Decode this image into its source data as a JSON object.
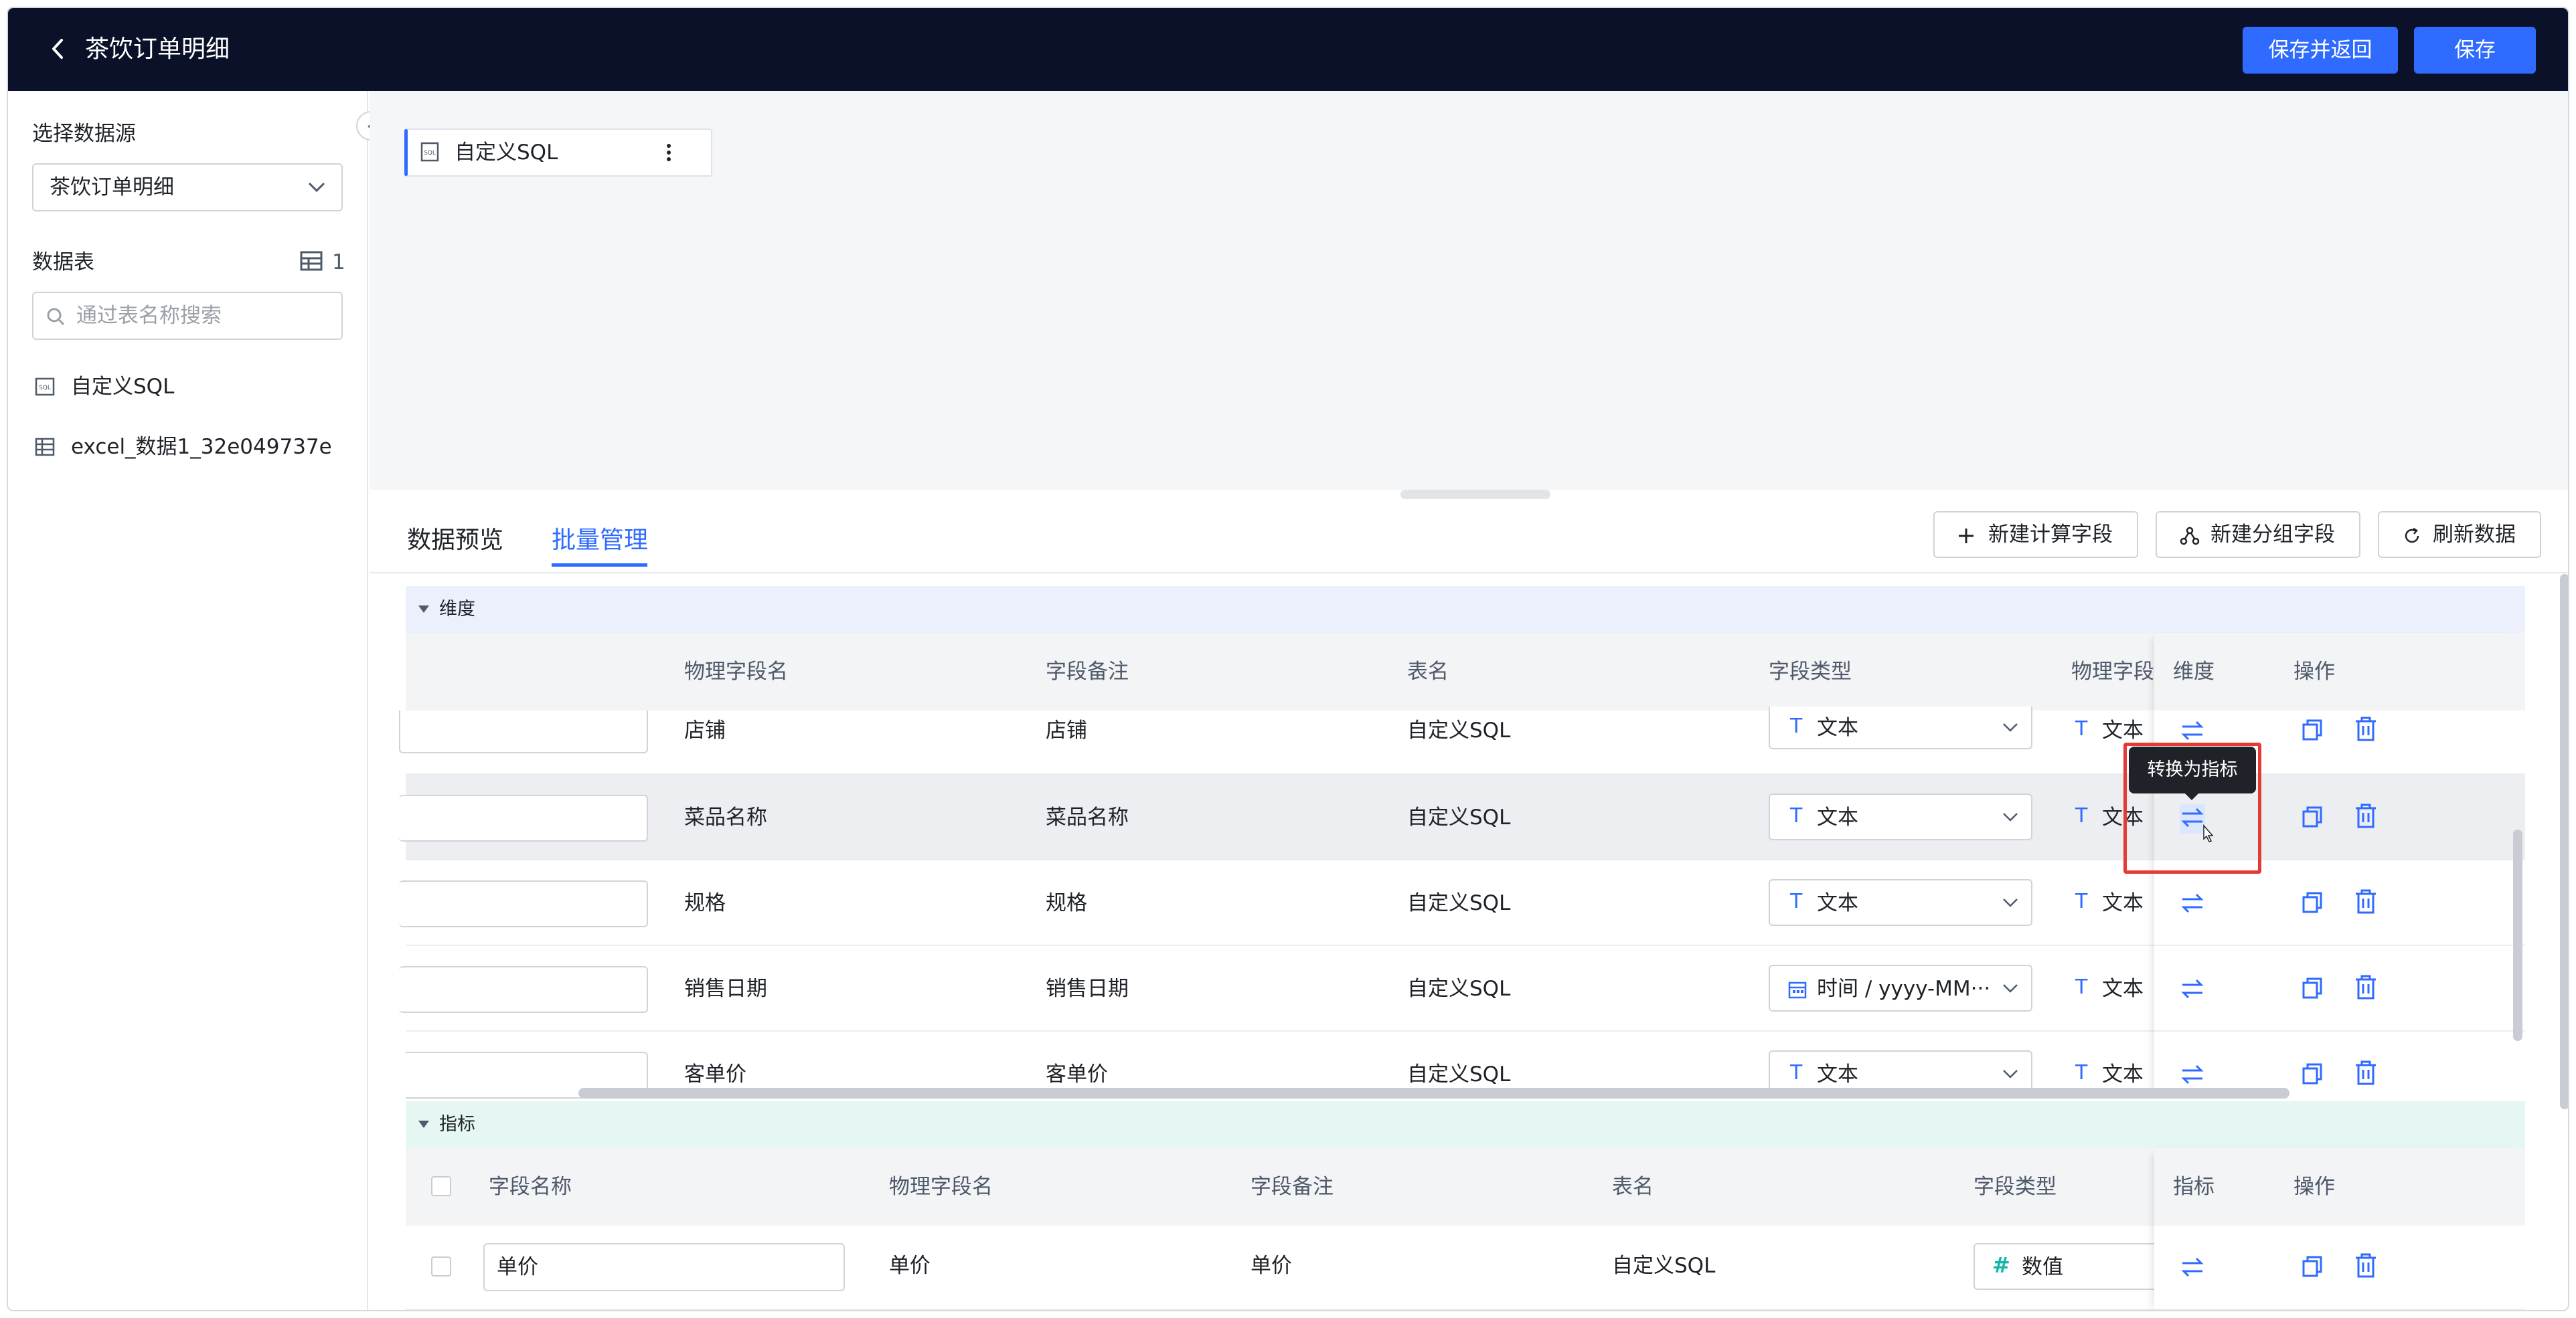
{
  "header": {
    "title": "茶饮订单明细",
    "save_return_label": "保存并返回",
    "save_label": "保存"
  },
  "sidebar": {
    "datasource_label": "选择数据源",
    "datasource_value": "茶饮订单明细",
    "tables_label": "数据表",
    "tables_count": "1",
    "search_placeholder": "通过表名称搜索",
    "tables": [
      {
        "name": "自定义SQL",
        "icon": "sql-file-icon"
      },
      {
        "name": "excel_数据1_32e049737e",
        "icon": "table-icon"
      }
    ]
  },
  "canvas": {
    "node_label": "自定义SQL"
  },
  "tabs": [
    {
      "label": "数据预览",
      "active": false
    },
    {
      "label": "批量管理",
      "active": true
    }
  ],
  "actions": {
    "new_calc_field": "新建计算字段",
    "new_group_field": "新建分组字段",
    "refresh_data": "刷新数据"
  },
  "dimension_group": {
    "title": "维度",
    "columns": [
      "物理字段名",
      "字段备注",
      "表名",
      "字段类型",
      "物理字段",
      "维度",
      "操作"
    ],
    "rows": [
      {
        "physical": "店铺",
        "remark": "店铺",
        "table": "自定义SQL",
        "type": "文本",
        "ptype": "文本"
      },
      {
        "physical": "菜品名称",
        "remark": "菜品名称",
        "table": "自定义SQL",
        "type": "文本",
        "ptype": "文本"
      },
      {
        "physical": "规格",
        "remark": "规格",
        "table": "自定义SQL",
        "type": "文本",
        "ptype": "文本"
      },
      {
        "physical": "销售日期",
        "remark": "销售日期",
        "table": "自定义SQL",
        "type": "时间 / yyyy-MM···",
        "ptype": "文本"
      },
      {
        "physical": "客单价",
        "remark": "客单价",
        "table": "自定义SQL",
        "type": "文本",
        "ptype": "文本"
      }
    ],
    "tooltip": "转换为指标"
  },
  "metric_group": {
    "title": "指标",
    "columns": [
      "字段名称",
      "物理字段名",
      "字段备注",
      "表名",
      "字段类型",
      "指标",
      "操作"
    ],
    "rows": [
      {
        "name": "单价",
        "physical": "单价",
        "remark": "单价",
        "table": "自定义SQL",
        "type": "数值"
      }
    ]
  },
  "colors": {
    "accent": "#2f6bff",
    "header_bg": "#0a1128",
    "dimension_bar": "#ecf0fd",
    "metric_bar": "#e6f6f3",
    "highlight": "#e53935",
    "metric_hash": "#14b8a6"
  }
}
